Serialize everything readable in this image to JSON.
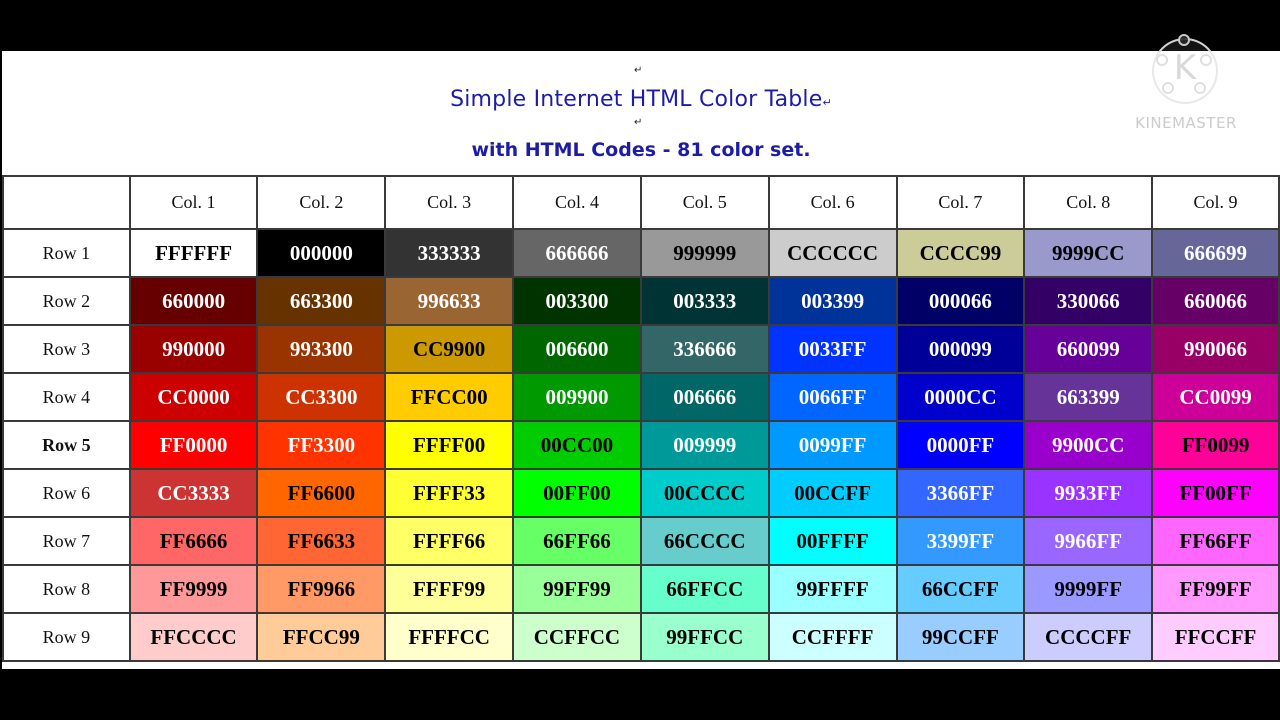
{
  "document": {
    "paragraph_mark": "↵",
    "title": "Simple Internet HTML Color Table",
    "subtitle": "with HTML Codes - 81 color set."
  },
  "watermark": {
    "logo_letter": "K",
    "brand": "KINEMASTER"
  },
  "table": {
    "column_headers": [
      "Col. 1",
      "Col. 2",
      "Col. 3",
      "Col. 4",
      "Col. 5",
      "Col. 6",
      "Col. 7",
      "Col. 8",
      "Col. 9"
    ],
    "rows": [
      {
        "label": "Row 1",
        "bold": false,
        "cells": [
          {
            "code": "FFFFFF",
            "bg": "#FFFFFF",
            "fg": "#000000"
          },
          {
            "code": "000000",
            "bg": "#000000",
            "fg": "#FFFFFF"
          },
          {
            "code": "333333",
            "bg": "#333333",
            "fg": "#FFFFFF"
          },
          {
            "code": "666666",
            "bg": "#666666",
            "fg": "#FFFFFF"
          },
          {
            "code": "999999",
            "bg": "#999999",
            "fg": "#000000"
          },
          {
            "code": "CCCCCC",
            "bg": "#CCCCCC",
            "fg": "#000000"
          },
          {
            "code": "CCCC99",
            "bg": "#CCCC99",
            "fg": "#000000"
          },
          {
            "code": "9999CC",
            "bg": "#9999CC",
            "fg": "#000000"
          },
          {
            "code": "666699",
            "bg": "#666699",
            "fg": "#FFFFFF"
          }
        ]
      },
      {
        "label": "Row 2",
        "bold": false,
        "cells": [
          {
            "code": "660000",
            "bg": "#660000",
            "fg": "#FFFFFF"
          },
          {
            "code": "663300",
            "bg": "#663300",
            "fg": "#FFFFFF"
          },
          {
            "code": "996633",
            "bg": "#996633",
            "fg": "#FFFFFF"
          },
          {
            "code": "003300",
            "bg": "#003300",
            "fg": "#FFFFFF"
          },
          {
            "code": "003333",
            "bg": "#003333",
            "fg": "#FFFFFF"
          },
          {
            "code": "003399",
            "bg": "#003399",
            "fg": "#FFFFFF"
          },
          {
            "code": "000066",
            "bg": "#000066",
            "fg": "#FFFFFF"
          },
          {
            "code": "330066",
            "bg": "#330066",
            "fg": "#FFFFFF"
          },
          {
            "code": "660066",
            "bg": "#660066",
            "fg": "#FFFFFF"
          }
        ]
      },
      {
        "label": "Row 3",
        "bold": false,
        "cells": [
          {
            "code": "990000",
            "bg": "#990000",
            "fg": "#FFFFFF"
          },
          {
            "code": "993300",
            "bg": "#993300",
            "fg": "#FFFFFF"
          },
          {
            "code": "CC9900",
            "bg": "#CC9900",
            "fg": "#000000"
          },
          {
            "code": "006600",
            "bg": "#006600",
            "fg": "#FFFFFF"
          },
          {
            "code": "336666",
            "bg": "#336666",
            "fg": "#FFFFFF"
          },
          {
            "code": "0033FF",
            "bg": "#0033FF",
            "fg": "#FFFFFF"
          },
          {
            "code": "000099",
            "bg": "#000099",
            "fg": "#FFFFFF"
          },
          {
            "code": "660099",
            "bg": "#660099",
            "fg": "#FFFFFF"
          },
          {
            "code": "990066",
            "bg": "#990066",
            "fg": "#FFFFFF"
          }
        ]
      },
      {
        "label": "Row 4",
        "bold": false,
        "cells": [
          {
            "code": "CC0000",
            "bg": "#CC0000",
            "fg": "#FFFFFF"
          },
          {
            "code": "CC3300",
            "bg": "#CC3300",
            "fg": "#FFFFFF"
          },
          {
            "code": "FFCC00",
            "bg": "#FFCC00",
            "fg": "#000000"
          },
          {
            "code": "009900",
            "bg": "#009900",
            "fg": "#FFFFFF"
          },
          {
            "code": "006666",
            "bg": "#006666",
            "fg": "#FFFFFF"
          },
          {
            "code": "0066FF",
            "bg": "#0066FF",
            "fg": "#FFFFFF"
          },
          {
            "code": "0000CC",
            "bg": "#0000CC",
            "fg": "#FFFFFF"
          },
          {
            "code": "663399",
            "bg": "#663399",
            "fg": "#FFFFFF"
          },
          {
            "code": "CC0099",
            "bg": "#CC0099",
            "fg": "#FFFFFF"
          }
        ]
      },
      {
        "label": "Row 5",
        "bold": true,
        "cells": [
          {
            "code": "FF0000",
            "bg": "#FF0000",
            "fg": "#FFFFFF"
          },
          {
            "code": "FF3300",
            "bg": "#FF3300",
            "fg": "#FFFFFF"
          },
          {
            "code": "FFFF00",
            "bg": "#FFFF00",
            "fg": "#000000"
          },
          {
            "code": "00CC00",
            "bg": "#00CC00",
            "fg": "#000000"
          },
          {
            "code": "009999",
            "bg": "#009999",
            "fg": "#FFFFFF"
          },
          {
            "code": "0099FF",
            "bg": "#0099FF",
            "fg": "#FFFFFF"
          },
          {
            "code": "0000FF",
            "bg": "#0000FF",
            "fg": "#FFFFFF"
          },
          {
            "code": "9900CC",
            "bg": "#9900CC",
            "fg": "#FFFFFF"
          },
          {
            "code": "FF0099",
            "bg": "#FF0099",
            "fg": "#000000"
          }
        ]
      },
      {
        "label": "Row 6",
        "bold": false,
        "cells": [
          {
            "code": "CC3333",
            "bg": "#CC3333",
            "fg": "#FFFFFF"
          },
          {
            "code": "FF6600",
            "bg": "#FF6600",
            "fg": "#000000"
          },
          {
            "code": "FFFF33",
            "bg": "#FFFF33",
            "fg": "#000000"
          },
          {
            "code": "00FF00",
            "bg": "#00FF00",
            "fg": "#000000"
          },
          {
            "code": "00CCCC",
            "bg": "#00CCCC",
            "fg": "#000000"
          },
          {
            "code": "00CCFF",
            "bg": "#00CCFF",
            "fg": "#000000"
          },
          {
            "code": "3366FF",
            "bg": "#3366FF",
            "fg": "#FFFFFF"
          },
          {
            "code": "9933FF",
            "bg": "#9933FF",
            "fg": "#FFFFFF"
          },
          {
            "code": "FF00FF",
            "bg": "#FF00FF",
            "fg": "#000000"
          }
        ]
      },
      {
        "label": "Row 7",
        "bold": false,
        "cells": [
          {
            "code": "FF6666",
            "bg": "#FF6666",
            "fg": "#000000"
          },
          {
            "code": "FF6633",
            "bg": "#FF6633",
            "fg": "#000000"
          },
          {
            "code": "FFFF66",
            "bg": "#FFFF66",
            "fg": "#000000"
          },
          {
            "code": "66FF66",
            "bg": "#66FF66",
            "fg": "#000000"
          },
          {
            "code": "66CCCC",
            "bg": "#66CCCC",
            "fg": "#000000"
          },
          {
            "code": "00FFFF",
            "bg": "#00FFFF",
            "fg": "#000000"
          },
          {
            "code": "3399FF",
            "bg": "#3399FF",
            "fg": "#FFFFFF"
          },
          {
            "code": "9966FF",
            "bg": "#9966FF",
            "fg": "#FFFFFF"
          },
          {
            "code": "FF66FF",
            "bg": "#FF66FF",
            "fg": "#000000"
          }
        ]
      },
      {
        "label": "Row 8",
        "bold": false,
        "cells": [
          {
            "code": "FF9999",
            "bg": "#FF9999",
            "fg": "#000000"
          },
          {
            "code": "FF9966",
            "bg": "#FF9966",
            "fg": "#000000"
          },
          {
            "code": "FFFF99",
            "bg": "#FFFF99",
            "fg": "#000000"
          },
          {
            "code": "99FF99",
            "bg": "#99FF99",
            "fg": "#000000"
          },
          {
            "code": "66FFCC",
            "bg": "#66FFCC",
            "fg": "#000000"
          },
          {
            "code": "99FFFF",
            "bg": "#99FFFF",
            "fg": "#000000"
          },
          {
            "code": "66CCFF",
            "bg": "#66CCFF",
            "fg": "#000000"
          },
          {
            "code": "9999FF",
            "bg": "#9999FF",
            "fg": "#000000"
          },
          {
            "code": "FF99FF",
            "bg": "#FF99FF",
            "fg": "#000000"
          }
        ]
      },
      {
        "label": "Row 9",
        "bold": false,
        "cells": [
          {
            "code": "FFCCCC",
            "bg": "#FFCCCC",
            "fg": "#000000"
          },
          {
            "code": "FFCC99",
            "bg": "#FFCC99",
            "fg": "#000000"
          },
          {
            "code": "FFFFCC",
            "bg": "#FFFFCC",
            "fg": "#000000"
          },
          {
            "code": "CCFFCC",
            "bg": "#CCFFCC",
            "fg": "#000000"
          },
          {
            "code": "99FFCC",
            "bg": "#99FFCC",
            "fg": "#000000"
          },
          {
            "code": "CCFFFF",
            "bg": "#CCFFFF",
            "fg": "#000000"
          },
          {
            "code": "99CCFF",
            "bg": "#99CCFF",
            "fg": "#000000"
          },
          {
            "code": "CCCCFF",
            "bg": "#CCCCFF",
            "fg": "#000000"
          },
          {
            "code": "FFCCFF",
            "bg": "#FFCCFF",
            "fg": "#000000"
          }
        ]
      }
    ]
  },
  "colors": {
    "title_text": "#1C1CA8",
    "letterbox": "#000000",
    "page_background": "#FFFFFF",
    "grid_line": "#3A3A3A"
  }
}
